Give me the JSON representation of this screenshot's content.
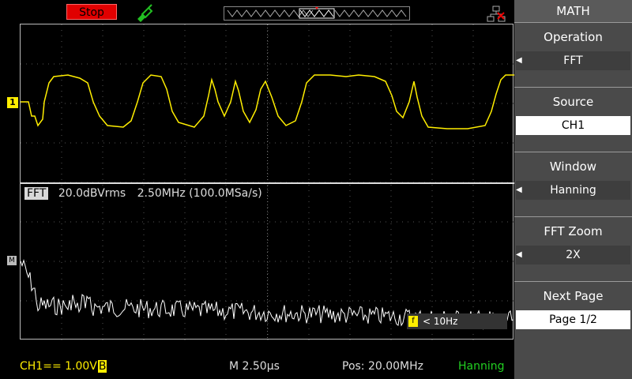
{
  "status": {
    "run_state": "Stop"
  },
  "trigger_marker": "T",
  "channel_marker": "1",
  "math_marker": "M",
  "fft_header": {
    "tag": "FFT",
    "scale": "20.0dBVrms",
    "rate": "2.50MHz (100.0MSa/s)"
  },
  "cursor_readout": {
    "tag": "f",
    "text": "< 10Hz"
  },
  "bottom": {
    "ch1_scale": "CH1== 1.00V",
    "bw_badge": "B",
    "timebase": "M 2.50µs",
    "position": "Pos: 20.00MHz",
    "window": "Hanning"
  },
  "menu": {
    "title": "MATH",
    "items": [
      {
        "label": "Operation",
        "value": "FFT",
        "selected": false,
        "arrow": true
      },
      {
        "label": "Source",
        "value": "CH1",
        "selected": true,
        "arrow": false
      },
      {
        "label": "Window",
        "value": "Hanning",
        "selected": false,
        "arrow": true
      },
      {
        "label": "FFT Zoom",
        "value": "2X",
        "selected": false,
        "arrow": true
      },
      {
        "label": "Next Page",
        "value": "Page 1/2",
        "selected": true,
        "arrow": false
      }
    ]
  },
  "colors": {
    "ch1": "#ffee00",
    "fft": "#ffffff",
    "window_status": "#22d022",
    "stop": "#e00000"
  },
  "icons": [
    "probe-icon",
    "network-icon",
    "trigger-position-icon",
    "left-arrow-icon"
  ]
}
